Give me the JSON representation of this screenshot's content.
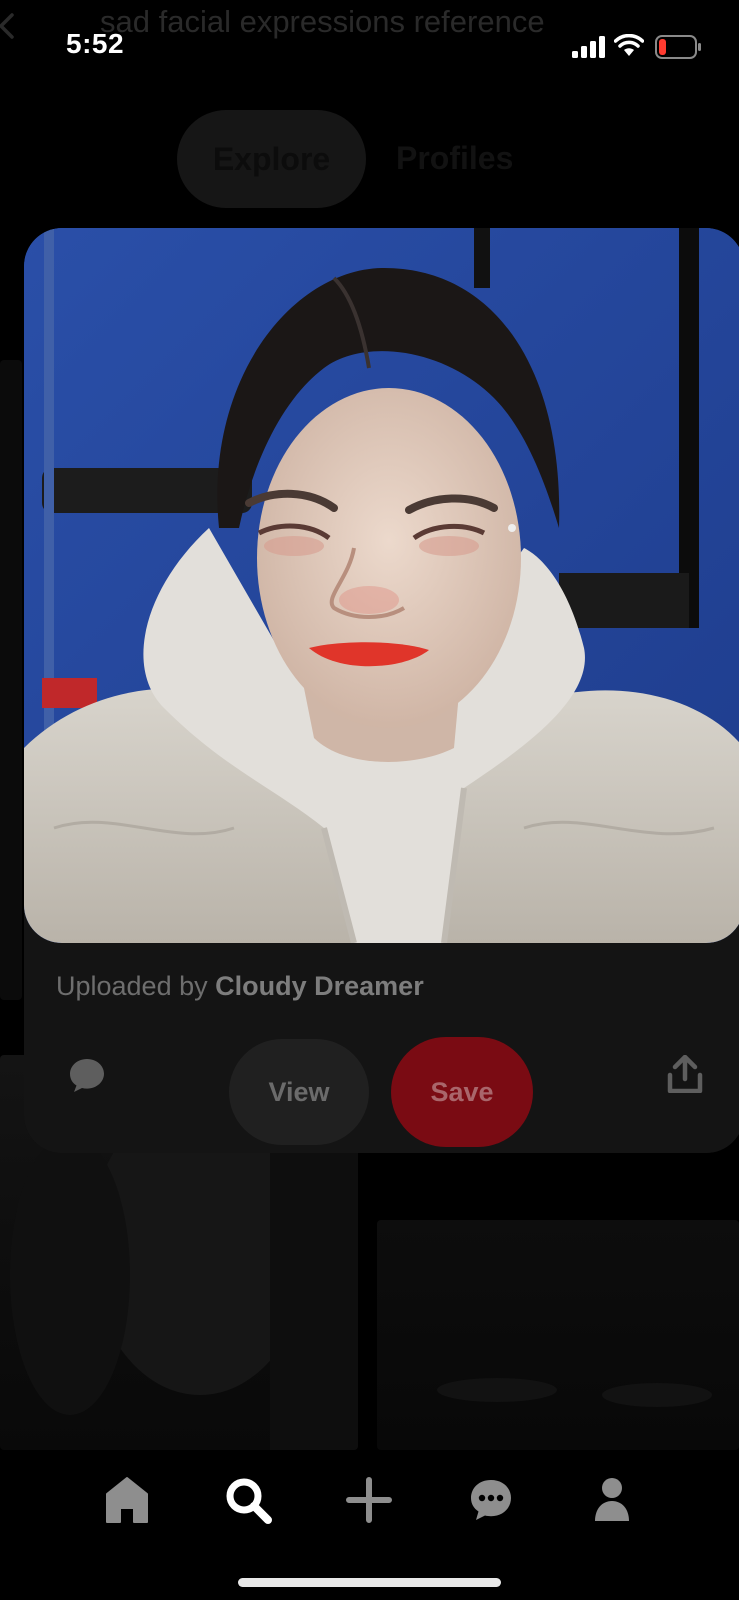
{
  "status_bar": {
    "time": "5:52"
  },
  "search": {
    "query": "sad facial expressions reference"
  },
  "tabs": [
    {
      "label": "Explore"
    },
    {
      "label": "Profiles"
    }
  ],
  "pin": {
    "uploaded_prefix": "Uploaded by",
    "uploader": "Cloudy Dreamer",
    "view_label": "View",
    "save_label": "Save"
  },
  "colors": {
    "save": "#e60023",
    "background": "#000000"
  },
  "icons": {
    "status": [
      "signal-icon",
      "wifi-icon",
      "battery-icon"
    ],
    "pin_actions": [
      "comment-icon",
      "share-icon"
    ],
    "nav": [
      "home-icon",
      "search-icon",
      "plus-icon",
      "chat-icon",
      "profile-icon"
    ]
  }
}
